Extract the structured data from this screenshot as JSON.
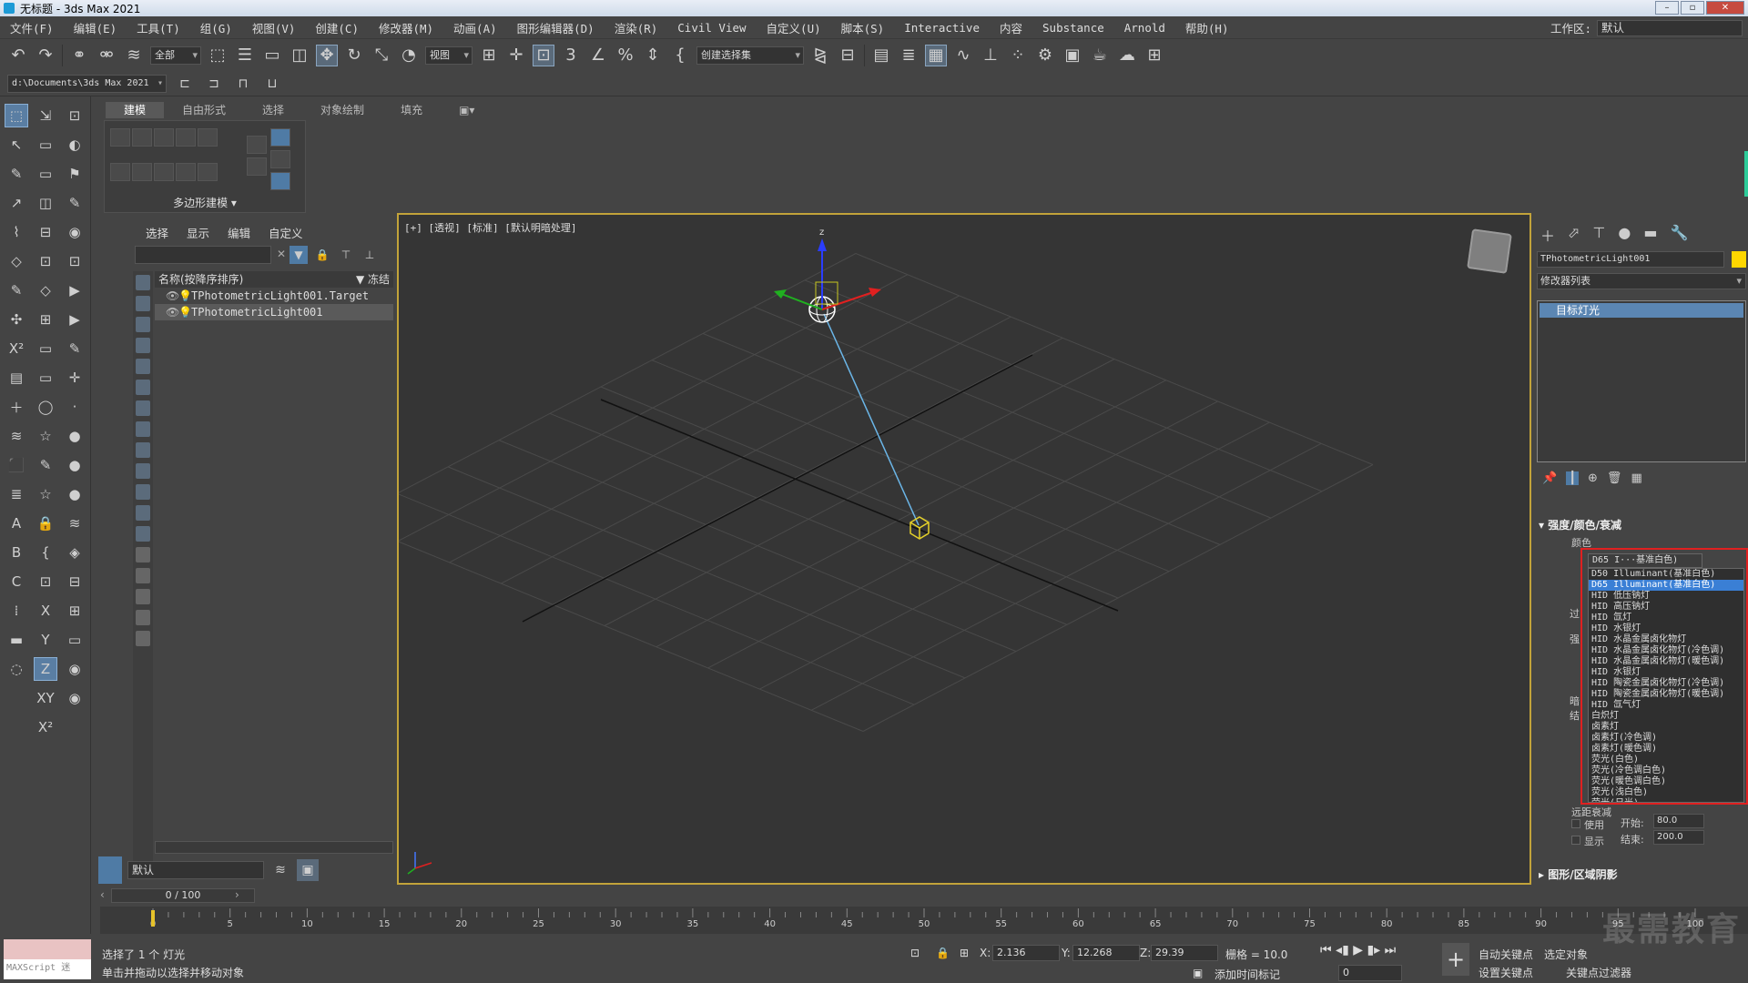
{
  "window": {
    "title": "无标题 - 3ds Max 2021",
    "minimize": "–",
    "maximize": "▫",
    "close": "✕"
  },
  "menu": {
    "items": [
      "文件(F)",
      "编辑(E)",
      "工具(T)",
      "组(G)",
      "视图(V)",
      "创建(C)",
      "修改器(M)",
      "动画(A)",
      "图形编辑器(D)",
      "渲染(R)",
      "Civil View",
      "自定义(U)",
      "脚本(S)",
      "Interactive",
      "内容",
      "Substance",
      "Arnold",
      "帮助(H)"
    ],
    "workspace_label": "工作区:",
    "workspace_value": "默认"
  },
  "toolbar": {
    "filter_select": "全部",
    "ref_coord": "视图",
    "named_selection": "创建选择集"
  },
  "path": {
    "project": "d:\\Documents\\3ds Max 2021"
  },
  "ribbon": {
    "tabs": [
      "建模",
      "自由形式",
      "选择",
      "对象绘制",
      "填充"
    ],
    "panel_label": "多边形建模"
  },
  "scene_explorer": {
    "menu": [
      "选择",
      "显示",
      "编辑",
      "自定义"
    ],
    "column_header": "名称(按降序排序)",
    "freeze_header": "▼ 冻结",
    "rows": [
      {
        "name": "TPhotometricLight001.Target",
        "selected": false
      },
      {
        "name": "TPhotometricLight001",
        "selected": true
      }
    ],
    "layer": "默认"
  },
  "viewport": {
    "label": "[+] [透视] [标准] [默认明暗处理]",
    "gizmo_z": "z"
  },
  "command_panel": {
    "object_name": "TPhotometricLight001",
    "object_color": "#ffd700",
    "modifier_list": "修改器列表",
    "stack_item": "目标灯光",
    "rollout_intensity": "强度/颜色/衰减",
    "color_label": "颜色",
    "far_atten_label": "远距衰减",
    "use_label": "使用",
    "show_label": "显示",
    "start_label": "开始:",
    "start_value": "80.0",
    "end_label": "结束:",
    "end_value": "200.0",
    "rollout_shape": "图形/区域阴影",
    "side_labels": [
      "过",
      "强",
      "暗",
      "结"
    ]
  },
  "dropdown": {
    "selected": "D65 I···基准白色)",
    "items": [
      "D50 Illuminant(基准白色)",
      "D65 Illuminant(基准白色)",
      "HID 低压钠灯",
      "HID 高压钠灯",
      "HID 氙灯",
      "HID 水银灯",
      "HID 水晶金属卤化物灯",
      "HID 水晶金属卤化物灯(冷色调)",
      "HID 水晶金属卤化物灯(暖色调)",
      "HID 水银灯",
      "HID 陶瓷金属卤化物灯(冷色调)",
      "HID 陶瓷金属卤化物灯(暖色调)",
      "HID 氙气灯",
      "白炽灯",
      "卤素灯",
      "卤素灯(冷色调)",
      "卤素灯(暖色调)",
      "荧光(白色)",
      "荧光(冷色调白色)",
      "荧光(暖色调白色)",
      "荧光(浅白色)",
      "荧光(日光)"
    ],
    "highlighted_index": 1
  },
  "timeline": {
    "frame_display": "0 / 100",
    "ticks": [
      "0",
      "5",
      "10",
      "15",
      "20",
      "25",
      "30",
      "35",
      "40",
      "45",
      "50",
      "55",
      "60",
      "65",
      "70",
      "75",
      "80",
      "85",
      "90",
      "95",
      "100"
    ]
  },
  "status": {
    "maxscript": "MAXScript 迷",
    "selection_text": "选择了 1 个 灯光",
    "prompt_text": "单击并拖动以选择并移动对象",
    "x_value": "2.136",
    "y_value": "12.268",
    "z_value": "29.39",
    "grid_text": "栅格 = 10.0",
    "add_time_tag": "添加时间标记",
    "auto_key": "自动关键点",
    "set_key": "设置关键点",
    "selected_obj": "选定对象",
    "key_filters": "关键点过滤器",
    "frame_field": "0",
    "watermark": "最需教育"
  }
}
